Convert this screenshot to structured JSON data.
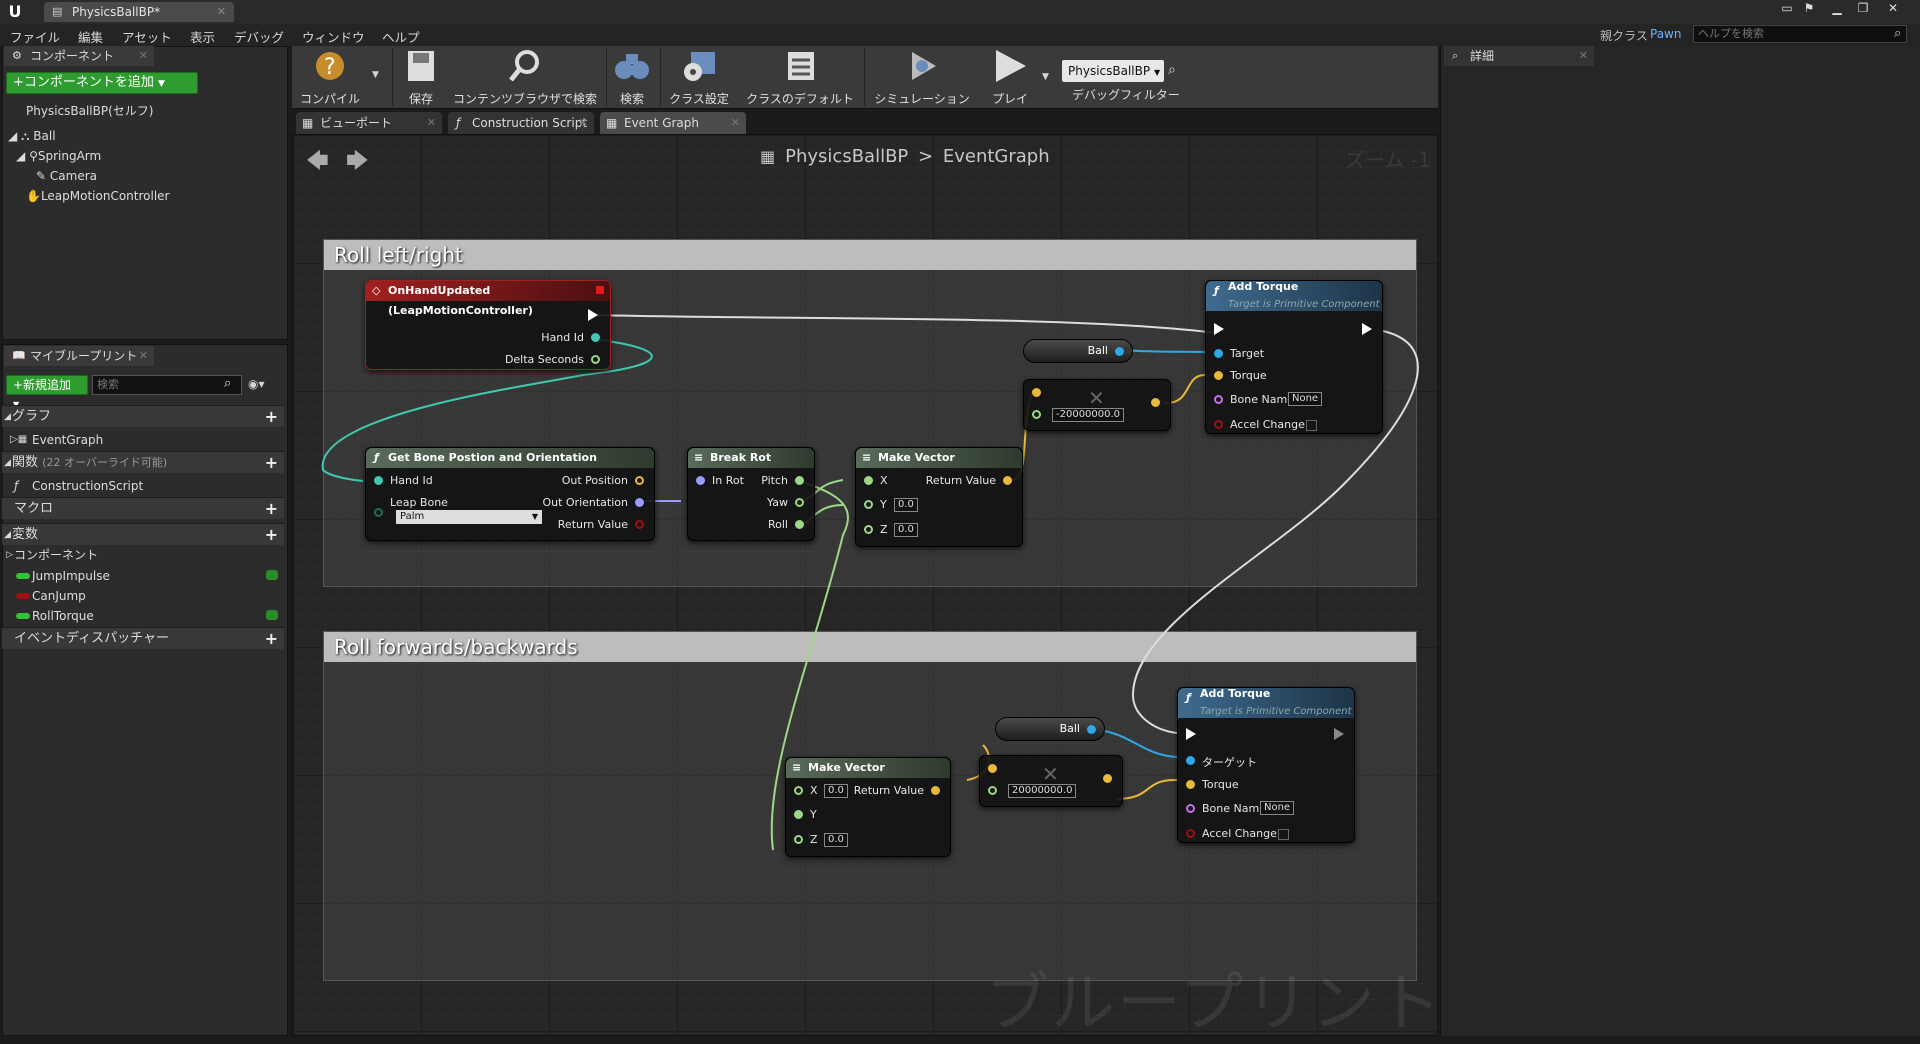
{
  "window": {
    "tab_title": "PhysicsBallBP*",
    "parent_class_label": "親クラス",
    "parent_class_value": "Pawn",
    "help_search_placeholder": "ヘルプを検索"
  },
  "menu": [
    "ファイル",
    "編集",
    "アセット",
    "表示",
    "デバッグ",
    "ウィンドウ",
    "ヘルプ"
  ],
  "components_panel": {
    "tab_label": "コンポーネント",
    "add_button": "+コンポーネントを追加",
    "root_self": "PhysicsBallBP(セルフ)",
    "tree": [
      {
        "label": "Ball",
        "indent": 0
      },
      {
        "label": "SpringArm",
        "indent": 1
      },
      {
        "label": "Camera",
        "indent": 2
      },
      {
        "label": "LeapMotionController",
        "indent": 1
      }
    ]
  },
  "my_blueprint": {
    "tab_label": "マイブループリント",
    "add_new_button": "+新規追加",
    "search_placeholder": "検索",
    "sections": {
      "graph": "グラフ",
      "graph_item": "EventGraph",
      "functions": "関数",
      "functions_note": "(22 オーバーライド可能)",
      "function_item": "ConstructionScript",
      "macros": "マクロ",
      "variables": "変数",
      "components": "コンポーネント",
      "dispatchers": "イベントディスパッチャー"
    },
    "variables": [
      {
        "name": "JumpImpulse",
        "color": "#35c435"
      },
      {
        "name": "CanJump",
        "color": "#a01010"
      },
      {
        "name": "RollTorque",
        "color": "#35c435"
      }
    ]
  },
  "toolbar": {
    "compile": "コンパイル",
    "save": "保存",
    "browse": "コンテンツブラウザで検索",
    "find": "検索",
    "class_settings": "クラス設定",
    "class_defaults": "クラスのデフォルト",
    "simulation": "シミュレーション",
    "play": "プレイ",
    "debug_target": "PhysicsBallBP",
    "debug_filter": "デバッグフィルター"
  },
  "graph_tabs": [
    "ビューポート",
    "Construction Script",
    "Event Graph"
  ],
  "graph": {
    "breadcrumb_root": "PhysicsBallBP",
    "breadcrumb_sep": ">",
    "breadcrumb_leaf": "EventGraph",
    "zoom": "ズーム -1",
    "watermark": "ブループリント",
    "comment_1": "Roll left/right",
    "comment_2": "Roll forwards/backwards",
    "event_node": {
      "title": "OnHandUpdated (LeapMotionController)",
      "pin_hand_id": "Hand Id",
      "pin_delta": "Delta Seconds"
    },
    "bone_node": {
      "title": "Get Bone Postion and Orientation",
      "pin_hand_id": "Hand Id",
      "pin_leap_bone": "Leap Bone",
      "leap_bone_value": "Palm",
      "out_position": "Out Position",
      "out_orientation": "Out Orientation",
      "return_value": "Return Value"
    },
    "break_rot": {
      "title": "Break Rot",
      "in_rot": "In Rot",
      "pitch": "Pitch",
      "yaw": "Yaw",
      "roll": "Roll"
    },
    "make_vector_1": {
      "title": "Make Vector",
      "x": "X",
      "y": "Y",
      "y_val": "0.0",
      "z": "Z",
      "z_val": "0.0",
      "ret": "Return Value"
    },
    "mult_1": {
      "value": "-20000000.0"
    },
    "ball_1": "Ball",
    "add_torque_1": {
      "title": "Add Torque",
      "subtitle": "Target is Primitive Component",
      "target": "Target",
      "torque": "Torque",
      "bone_name": "Bone Name",
      "bone_val": "None",
      "accel": "Accel Change"
    },
    "make_vector_2": {
      "title": "Make Vector",
      "x": "X",
      "x_val": "0.0",
      "y": "Y",
      "z": "Z",
      "z_val": "0.0",
      "ret": "Return Value"
    },
    "mult_2": {
      "value": "20000000.0"
    },
    "ball_2": "Ball",
    "add_torque_2": {
      "title": "Add Torque",
      "subtitle": "Target is Primitive Component",
      "target": "ターゲット",
      "torque": "Torque",
      "bone_name": "Bone Name",
      "bone_val": "None",
      "accel": "Accel Change"
    }
  },
  "details_panel": {
    "tab_label": "詳細"
  }
}
